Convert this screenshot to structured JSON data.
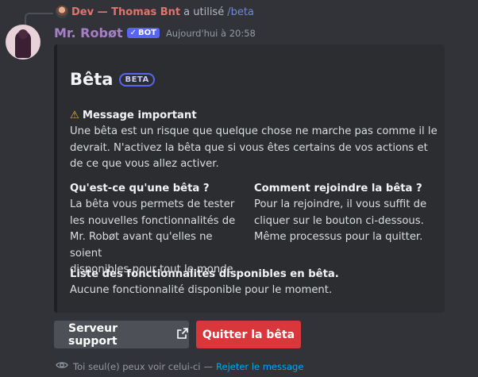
{
  "reply": {
    "author": "Dev — Thomas Bnt",
    "used_text": "a utilisé",
    "command": "/beta"
  },
  "message": {
    "bot_name": "Mr. Robøt",
    "bot_tag": "BOT",
    "timestamp": "Aujourd'hui à 20:58"
  },
  "embed": {
    "title": "Bêta",
    "badge": "BETA",
    "important": {
      "name": "Message important",
      "value_lines": [
        "Une bêta est un risque que quelque chose ne marche pas comme il le",
        "devrait. N'activez la bêta que si vous êtes certains de vos actions et",
        "de ce que vous allez activer."
      ]
    },
    "what_is": {
      "name": "Qu'est-ce qu'une bêta ?",
      "value_lines": [
        "La bêta vous permets de tester",
        "les nouvelles fonctionnalités de",
        "Mr. Robøt avant qu'elles ne soient",
        "disponibles pour tout le monde."
      ]
    },
    "how_to_join": {
      "name": "Comment rejoindre la bêta ?",
      "value_lines": [
        "Pour la rejoindre, il vous suffit de",
        "cliquer sur le bouton ci-dessous.",
        "Même processus pour la quitter."
      ]
    },
    "features": {
      "name": "Liste des fonctionnalités disponibles en bêta.",
      "value": "Aucune fonctionnalité disponible pour le moment."
    }
  },
  "buttons": {
    "support": "Serveur support",
    "quit": "Quitter la bêta"
  },
  "ephemeral": {
    "notice": "Toi seul(e) peux voir celui-ci",
    "separator": "—",
    "dismiss": "Rejeter le message"
  },
  "colors": {
    "background": "#313338",
    "embed_bg": "#2b2d31",
    "author": "#e2736f",
    "bot_name": "#a77ec9",
    "blurple": "#5865f2",
    "danger": "#da373c",
    "link": "#00a8fc"
  }
}
